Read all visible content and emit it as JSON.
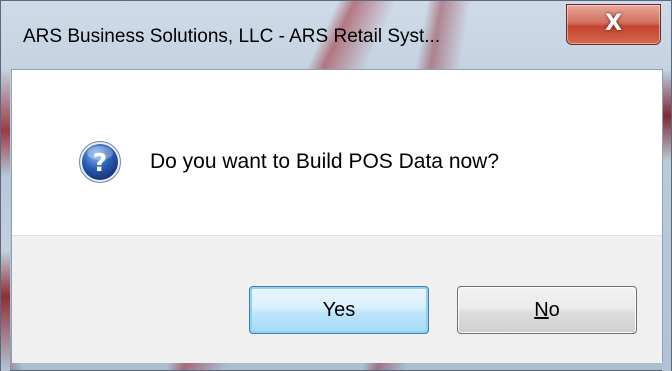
{
  "window": {
    "title": "ARS Business Solutions, LLC - ARS Retail Syst...",
    "close_glyph": "X"
  },
  "dialog": {
    "icon": "question-icon",
    "message": "Do you want to Build POS Data now?"
  },
  "buttons": {
    "yes_label": "Yes",
    "no_mnemonic": "N",
    "no_rest": "o"
  },
  "colors": {
    "icon_blue": "#2a5db8",
    "default_button_border": "#3c7fb1",
    "close_red": "#c3432e"
  }
}
